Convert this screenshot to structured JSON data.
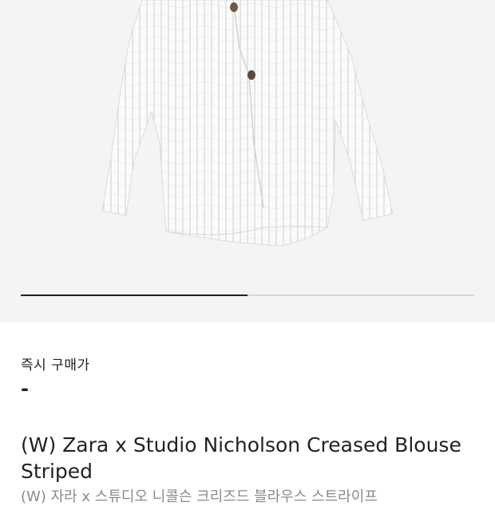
{
  "gallery": {
    "progress": 0.5,
    "image_icon": "striped-blouse-image"
  },
  "price": {
    "label": "즉시 구매가",
    "value": "-"
  },
  "product": {
    "name_en": "(W) Zara x Studio Nicholson Creased Blouse Striped",
    "name_ko": "(W) 자라 x 스튜디오 니콜슨 크리즈드 블라우스 스트라이프"
  }
}
